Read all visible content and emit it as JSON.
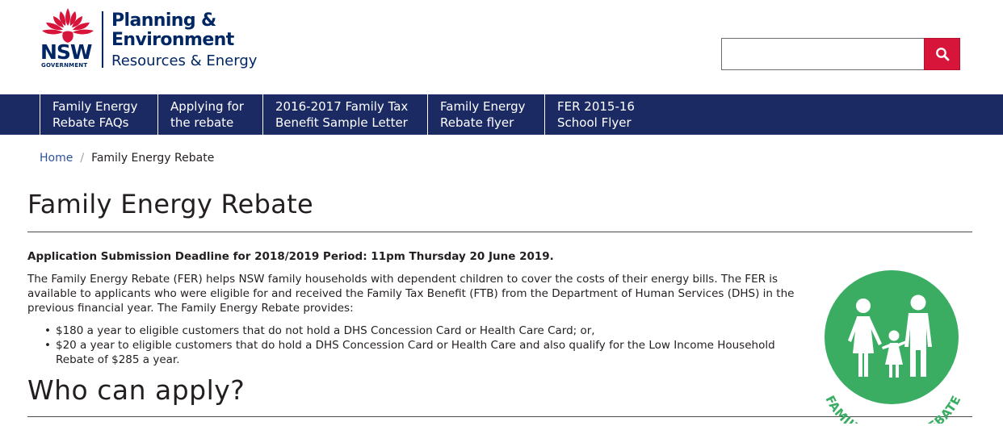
{
  "header": {
    "logo": {
      "nsw": "NSW",
      "government": "GOVERNMENT",
      "dept_line1": "Planning &",
      "dept_line2": "Environment",
      "dept_line3": "Resources & Energy"
    },
    "search": {
      "placeholder": "",
      "value": "",
      "button_icon": "search-icon"
    }
  },
  "nav": {
    "items": [
      {
        "line1": "Family Energy",
        "line2": "Rebate FAQs"
      },
      {
        "line1": "Applying for",
        "line2": "the rebate"
      },
      {
        "line1": "2016-2017 Family Tax",
        "line2": "Benefit Sample Letter"
      },
      {
        "line1": "Family Energy",
        "line2": "Rebate flyer"
      },
      {
        "line1": "FER 2015-16",
        "line2": "School Flyer"
      }
    ]
  },
  "breadcrumb": {
    "home": "Home",
    "separator": "/",
    "current": "Family Energy Rebate"
  },
  "main": {
    "title": "Family Energy Rebate",
    "deadline": "Application Submission Deadline for 2018/2019 Period: 11pm Thursday 20 June 2019.",
    "intro": "The Family Energy Rebate (FER) helps NSW family households with dependent children to cover the costs of their energy bills. The FER is available to applicants who were eligible for and received the Family Tax Benefit (FTB) from the Department of Human Services (DHS) in the previous financial year. The Family Energy Rebate provides:",
    "bullets": [
      "$180 a year to eligible customers that do not hold a DHS Concession Card or Health Care Card; or,",
      "$20 a year to eligible customers that do hold a DHS Concession Card or Health Care and also qualify for the Low Income Household Rebate of $285 a year."
    ],
    "subheading": "Who can apply?"
  },
  "fer_logo": {
    "text": "FAMILY ENERGY REBATE",
    "icon": "family-icon"
  },
  "colors": {
    "navy": "#1b2a63",
    "brand_red": "#d7153a",
    "fer_green": "#3aad62",
    "link_blue": "#2e5299"
  }
}
